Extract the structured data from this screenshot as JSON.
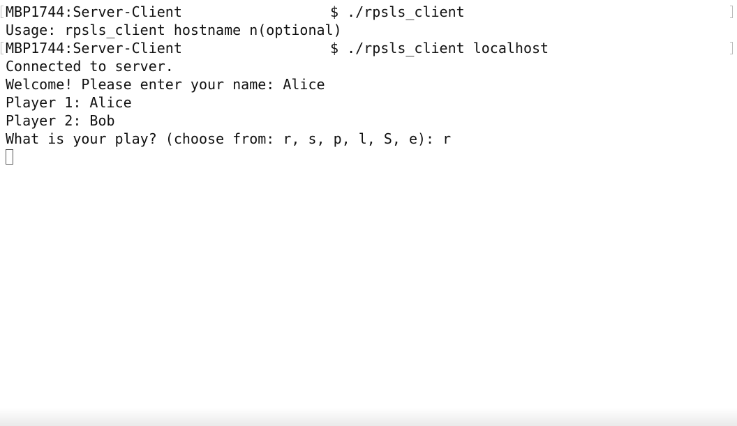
{
  "terminal": {
    "lines": [
      {
        "type": "prompt",
        "host": "MBP1744:Server-Client",
        "command": "$ ./rpsls_client"
      },
      {
        "type": "output",
        "text": "Usage: rpsls_client hostname n(optional)"
      },
      {
        "type": "prompt",
        "host": "MBP1744:Server-Client",
        "command": "$ ./rpsls_client localhost"
      },
      {
        "type": "output",
        "text": "Connected to server."
      },
      {
        "type": "output",
        "text": "Welcome! Please enter your name: Alice"
      },
      {
        "type": "output",
        "text": "Player 1: Alice"
      },
      {
        "type": "output",
        "text": "Player 2: Bob"
      },
      {
        "type": "output",
        "text": "What is your play? (choose from: r, s, p, l, S, e): r"
      }
    ],
    "cursor_icon": "block-cursor-icon",
    "mark_icon": "bracket-mark-icon"
  }
}
